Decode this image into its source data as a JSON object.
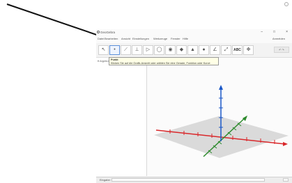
{
  "window": {
    "title": "GeoGebra",
    "controls": {
      "minimize": "–",
      "maximize": "□",
      "close": "×"
    }
  },
  "menu": {
    "items": [
      "Datei",
      "Bearbeiten",
      "Ansicht",
      "Einstellungen",
      "Werkzeuge",
      "Fenster",
      "Hilfe"
    ],
    "sign_in": "Anmelden"
  },
  "toolbar": {
    "tools": [
      {
        "name": "move-tool",
        "glyph": "↖",
        "active": false
      },
      {
        "name": "point-tool",
        "glyph": "•",
        "active": true
      },
      {
        "name": "line-tool",
        "glyph": "⟋",
        "active": false
      },
      {
        "name": "perpendicular-tool",
        "glyph": "⊥",
        "active": false
      },
      {
        "name": "polygon-tool",
        "glyph": "▷",
        "active": false
      },
      {
        "name": "circle-tool",
        "glyph": "◯",
        "active": false
      },
      {
        "name": "intersect-tool",
        "glyph": "◉",
        "active": false
      },
      {
        "name": "plane-tool",
        "glyph": "◆",
        "active": false
      },
      {
        "name": "pyramid-tool",
        "glyph": "▲",
        "active": false
      },
      {
        "name": "sphere-tool",
        "glyph": "●",
        "active": false
      },
      {
        "name": "angle-tool",
        "glyph": "∠",
        "active": false
      },
      {
        "name": "reflect-tool",
        "glyph": "⤢",
        "active": false
      },
      {
        "name": "text-tool",
        "glyph": "ABC",
        "active": false
      },
      {
        "name": "view-tool",
        "glyph": "✥",
        "active": false
      }
    ]
  },
  "tooltip": {
    "title": "Punkt",
    "text": "Klicken Sie auf die Grafik-Ansicht oder wählen Sie eine Gerade, Funktion oder Kurve"
  },
  "algebra_view": {
    "header": "▾ Algebra"
  },
  "input_bar": {
    "label": "Eingabe:"
  },
  "colors": {
    "x_axis": "#d9272a",
    "y_axis": "#2c8a2c",
    "z_axis": "#1a57c7",
    "plane": "#cfcfcf",
    "pointer": "#111111"
  }
}
